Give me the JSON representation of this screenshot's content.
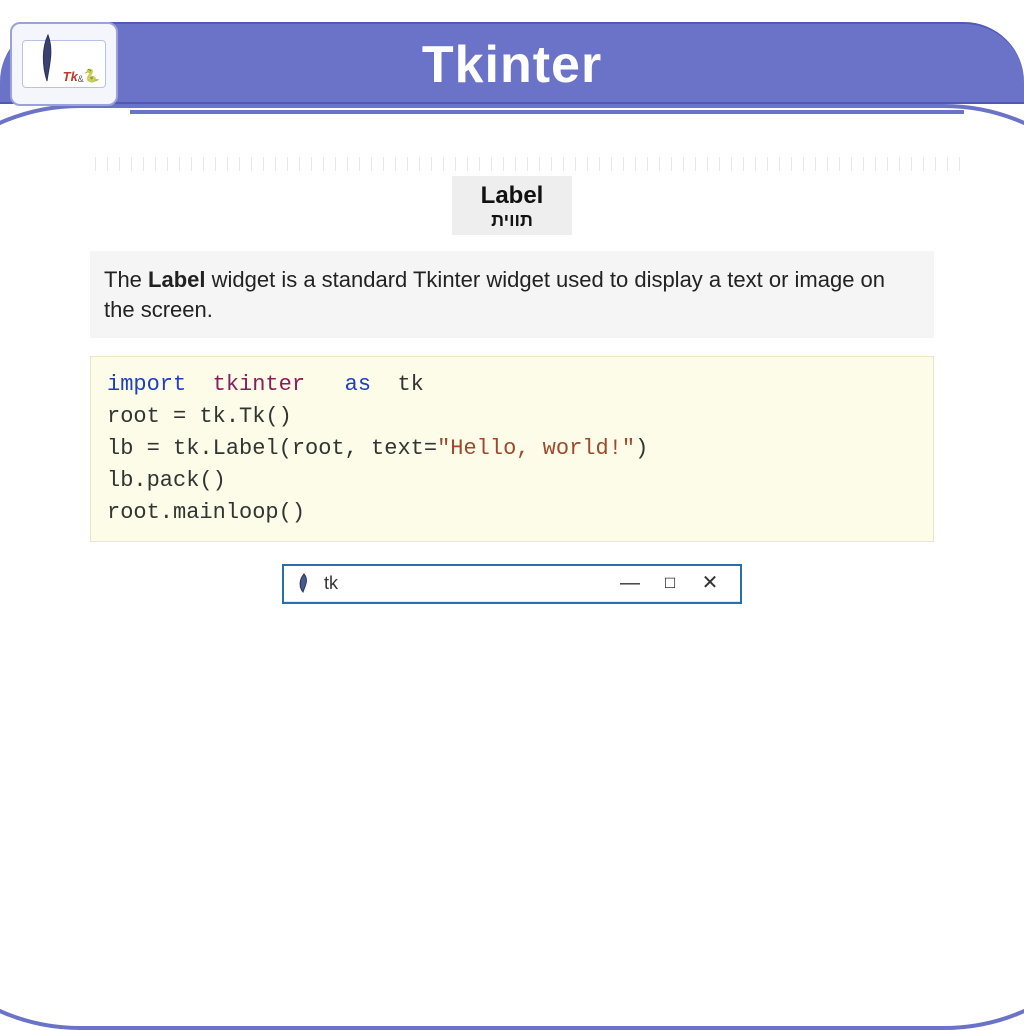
{
  "header": {
    "title": "Tkinter"
  },
  "logo": {
    "text_tk": "Tk",
    "text_amp": "&",
    "snake_glyph": "🐍"
  },
  "subtitle": {
    "main": "Label",
    "hebrew": "תווית"
  },
  "description": {
    "prefix": "The ",
    "bold": "Label",
    "suffix": " widget is a standard Tkinter widget used to display a text or image on the screen."
  },
  "code": {
    "l1_import": "import",
    "l1_mod": "tkinter",
    "l1_as": "as",
    "l1_alias": "tk",
    "l2": "root = tk.Tk()",
    "l3_pre": "lb = tk.Label(root, text=",
    "l3_str": "\"Hello, world!\"",
    "l3_post": ")",
    "l4": "lb.pack()",
    "l5": "root.mainloop()"
  },
  "tk_window": {
    "title": "tk",
    "min": "—",
    "max": "☐",
    "close": "✕"
  }
}
